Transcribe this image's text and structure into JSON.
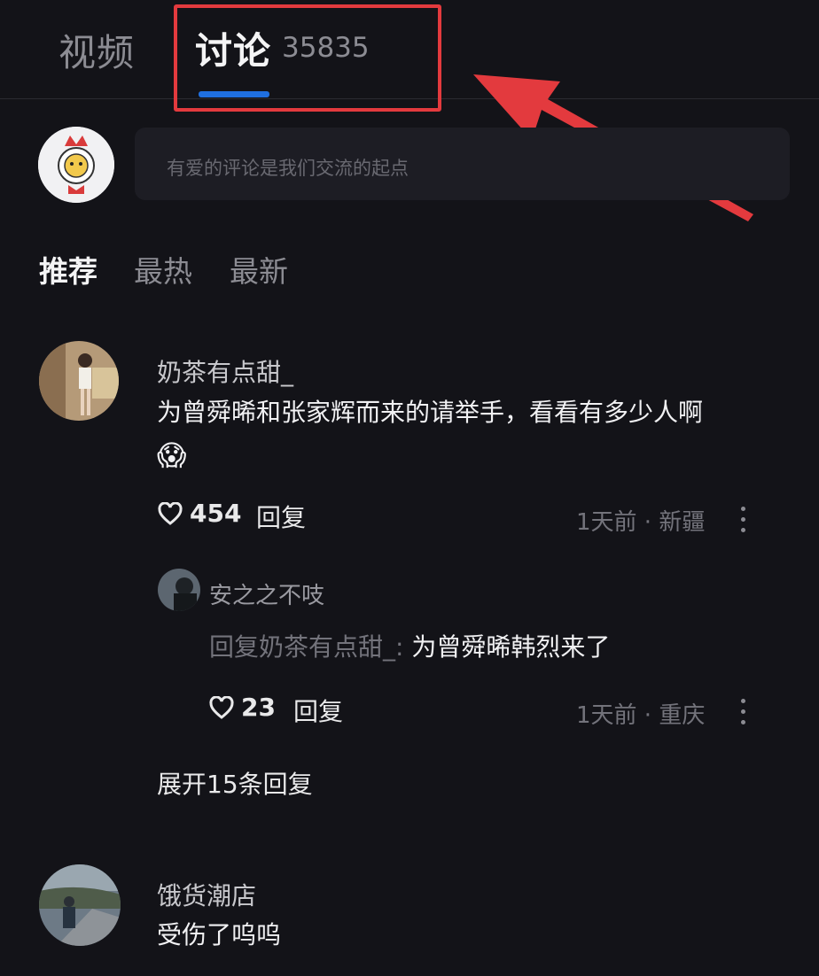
{
  "tabs": {
    "video_label": "视频",
    "discuss_label": "讨论",
    "discuss_count": "35835"
  },
  "composer": {
    "placeholder": "有爱的评论是我们交流的起点"
  },
  "sort_tabs": [
    "推荐",
    "最热",
    "最新"
  ],
  "comments": [
    {
      "author": "奶茶有点甜_",
      "text": "为曾舜晞和张家辉而来的请举手，看看有多少人啊",
      "emoji": "😱",
      "likes": "454",
      "reply_label": "回复",
      "meta": "1天前 · 新疆",
      "reply": {
        "author": "安之之不吱",
        "prefix": "回复奶茶有点甜_: ",
        "text": "为曾舜晞韩烈来了",
        "likes": "23",
        "reply_label": "回复",
        "meta": "1天前 · 重庆"
      },
      "expand_label": "展开15条回复"
    },
    {
      "author": "饿货潮店",
      "text": "受伤了呜呜"
    }
  ],
  "colors": {
    "accent": "#1f6fe0",
    "annotation_red": "#e33a3e",
    "background": "#131318"
  },
  "icons": [
    "heart-outline-icon",
    "more-vertical-icon",
    "arrow-annotation-icon"
  ]
}
